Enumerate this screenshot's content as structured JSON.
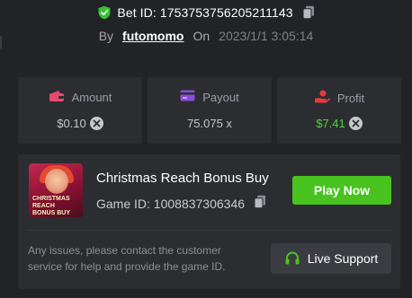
{
  "header": {
    "bet_id": "Bet ID: 1753753756205211143",
    "by_label": "By",
    "username": "futomomo",
    "on_label": "On",
    "date": "2023/1/1 3:05:14"
  },
  "stats": {
    "amount": {
      "label": "Amount",
      "value": "$0.10",
      "icon": "wallet-icon",
      "color": "#e94a6b"
    },
    "payout": {
      "label": "Payout",
      "value": "75.075 x",
      "icon": "card-icon",
      "color": "#8b4ddc"
    },
    "profit": {
      "label": "Profit",
      "value": "$7.41",
      "icon": "hand-coin-icon",
      "color": "#e23b3b",
      "value_color": "#4ed33b"
    }
  },
  "game": {
    "title": "Christmas Reach Bonus Buy",
    "game_id": "Game ID: 1008837306346",
    "thumb_text": "CHRISTMAS REACH BONUS BUY",
    "play_label": "Play Now",
    "play_color": "#49c31f"
  },
  "support": {
    "notice": "Any issues, please contact the customer service for help and provide the game ID.",
    "button_label": "Live Support",
    "icon_color": "#49c31f"
  }
}
